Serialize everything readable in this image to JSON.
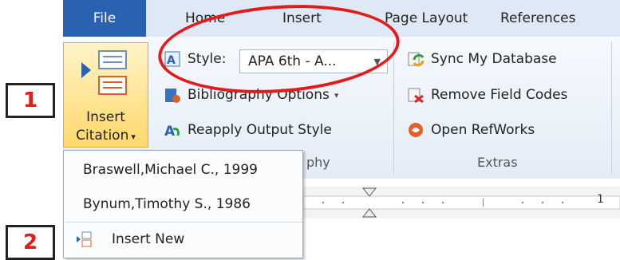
{
  "tabs": {
    "file": "File",
    "home": "Home",
    "insert": "Insert",
    "page_layout": "Page Layout",
    "references": "References"
  },
  "citations_group": {
    "insert_citation_line1": "Insert",
    "insert_citation_line2": "Citation",
    "style_label": "Style:",
    "style_value": "APA 6th - A...",
    "bibliography_options": "Bibliography Options",
    "reapply_output_style": "Reapply Output Style",
    "group_label_partial": "phy"
  },
  "extras_group": {
    "sync_my_database": "Sync My Database",
    "remove_field_codes": "Remove Field Codes",
    "open_refworks": "Open RefWorks",
    "group_label": "Extras"
  },
  "citation_menu": {
    "items": [
      {
        "label": "Braswell,Michael C., 1999"
      },
      {
        "label": "Bynum,Timothy S., 1986"
      }
    ],
    "insert_new": "Insert New"
  },
  "ruler": {
    "number": "1"
  },
  "callouts": {
    "one": "1",
    "two": "2"
  },
  "colors": {
    "callout_red": "#e21b1b",
    "file_tab_blue": "#2a62b1",
    "button_highlight": "#ffd86b"
  }
}
